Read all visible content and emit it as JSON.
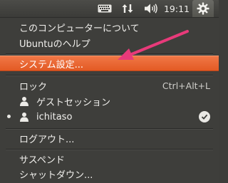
{
  "topbar": {
    "keyboard_icon": "keyboard-icon",
    "network_icon": "network-updown-icon",
    "volume_icon": "volume-icon",
    "time": "19:11",
    "gear_icon": "gear-icon"
  },
  "menu": {
    "about": "このコンピューターについて",
    "help": "Ubuntuのヘルプ",
    "system_settings": "システム設定...",
    "lock": "ロック",
    "lock_shortcut": "Ctrl+Alt+L",
    "guest_session": "ゲストセッション",
    "current_user": "ichitaso",
    "logout": "ログアウト...",
    "suspend": "サスペンド",
    "shutdown": "シャットダウン..."
  },
  "colors": {
    "highlight": "#e8602c",
    "arrow": "#e83a7a",
    "panel": "#3e3e3b"
  }
}
